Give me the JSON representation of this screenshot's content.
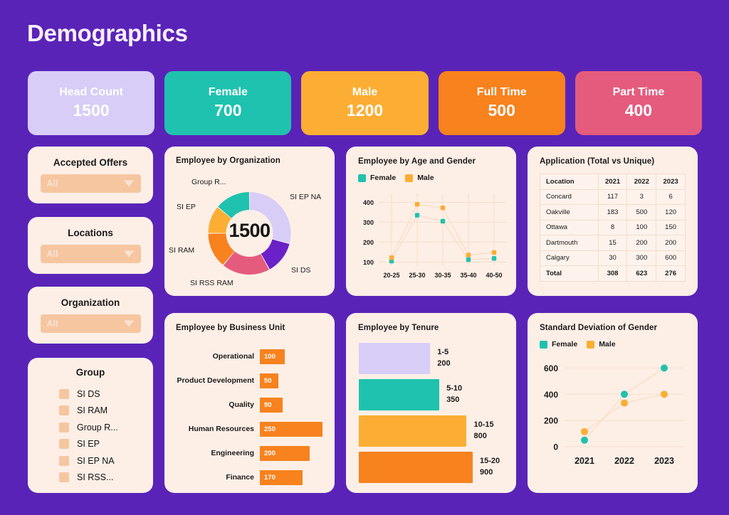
{
  "header": {
    "title": "Demographics"
  },
  "theme": {
    "background": "#5A23B8",
    "card_bg": "#FDEFE6",
    "teal": "#1FC2AE",
    "amber": "#FBAE33",
    "orange": "#F7821E",
    "pink": "#E55B7E",
    "lavender": "#D8CDF7",
    "deep_purple": "#6B21C8",
    "peach": "#F6C6A1"
  },
  "kpis": [
    {
      "label": "Head Count",
      "value": "1500",
      "color": "#D8CDF7"
    },
    {
      "label": "Female",
      "value": "700",
      "color": "#1FC2AE"
    },
    {
      "label": "Male",
      "value": "1200",
      "color": "#FBAE33"
    },
    {
      "label": "Full Time",
      "value": "500",
      "color": "#F7821E"
    },
    {
      "label": "Part Time",
      "value": "400",
      "color": "#E55B7E"
    }
  ],
  "filters": [
    {
      "label": "Accepted Offers",
      "value": "All"
    },
    {
      "label": "Locations",
      "value": "All"
    },
    {
      "label": "Organization",
      "value": "All"
    }
  ],
  "group_legend": {
    "title": "Group",
    "items": [
      "SI DS",
      "SI RAM",
      "Group R...",
      "SI EP",
      "SI EP NA",
      "SI RSS..."
    ]
  },
  "chart_data": [
    {
      "id": "employee_by_organization",
      "type": "pie",
      "title": "Employee by Organization",
      "center_label": "1500",
      "labels": [
        "SI EP NA",
        "SI DS",
        "SI RSS RAM",
        "SI RAM",
        "SI EP",
        "Group R..."
      ],
      "values": [
        29,
        13,
        19,
        14,
        11,
        14
      ],
      "colors": [
        "#D8CDF7",
        "#6B21C8",
        "#E55B7E",
        "#F7821E",
        "#FBAE33",
        "#1FC2AE"
      ]
    },
    {
      "id": "employee_by_age_and_gender",
      "type": "line",
      "title": "Employee by Age and Gender",
      "categories": [
        "20-25",
        "25-30",
        "30-35",
        "35-40",
        "40-50"
      ],
      "series": [
        {
          "name": "Female",
          "color": "#1FC2AE",
          "values": [
            105,
            335,
            305,
            112,
            118
          ]
        },
        {
          "name": "Male",
          "color": "#FBAE33",
          "values": [
            122,
            390,
            372,
            135,
            148
          ]
        }
      ],
      "yticks": [
        100,
        200,
        300,
        400
      ],
      "ylim": [
        80,
        430
      ],
      "grid": true,
      "legend_position": "top-left"
    },
    {
      "id": "application_total_vs_unique",
      "type": "table",
      "title": "Application (Total vs Unique)",
      "columns": [
        "Location",
        "2021",
        "2022",
        "2023"
      ],
      "rows": [
        [
          "Concard",
          "117",
          "3",
          "6"
        ],
        [
          "Oakville",
          "183",
          "500",
          "120"
        ],
        [
          "Ottawa",
          "8",
          "100",
          "150"
        ],
        [
          "Dartmouth",
          "15",
          "200",
          "200"
        ],
        [
          "Calgary",
          "30",
          "300",
          "600"
        ],
        [
          "Total",
          "308",
          "623",
          "276"
        ]
      ]
    },
    {
      "id": "employee_by_business_unit",
      "type": "bar",
      "title": "Employee by Business Unit",
      "orientation": "horizontal",
      "categories": [
        "Operational",
        "Product Development",
        "Quality",
        "Human Resources",
        "Engineering",
        "Finance"
      ],
      "values": [
        100,
        50,
        90,
        250,
        200,
        170
      ],
      "color": "#F7821E",
      "max": 250
    },
    {
      "id": "employee_by_tenure",
      "type": "bar",
      "title": "Employee by Tenure",
      "orientation": "horizontal",
      "categories": [
        "1-5",
        "5-10",
        "10-15",
        "15-20"
      ],
      "values": [
        200,
        350,
        800,
        900
      ],
      "colors": [
        "#D8CDF7",
        "#1FC2AE",
        "#FBAE33",
        "#F7821E"
      ],
      "max": 900
    },
    {
      "id": "standard_deviation_of_gender",
      "type": "line",
      "title": "Standard Deviation of Gender",
      "categories": [
        "2021",
        "2022",
        "2023"
      ],
      "series": [
        {
          "name": "Female",
          "color": "#1FC2AE",
          "values": [
            50,
            400,
            600
          ]
        },
        {
          "name": "Male",
          "color": "#FBAE33",
          "values": [
            115,
            333,
            400
          ]
        }
      ],
      "yticks": [
        0,
        200,
        400,
        600
      ],
      "ylim": [
        0,
        640
      ],
      "grid": true,
      "legend_position": "top-left"
    }
  ]
}
